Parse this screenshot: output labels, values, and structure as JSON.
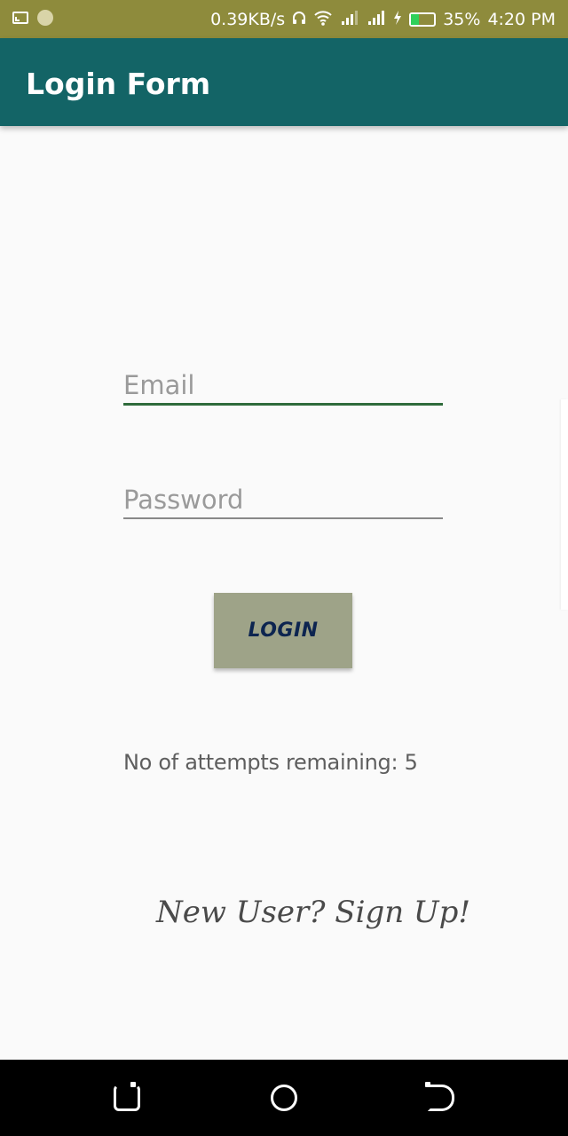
{
  "status_bar": {
    "network_speed": "0.39KB/s",
    "battery_percent": "35%",
    "time": "4:20 PM",
    "icons": [
      "cast-icon",
      "notification-dot-icon",
      "headphones-icon",
      "wifi-icon",
      "signal-icon",
      "signal-icon",
      "charging-icon",
      "battery-icon"
    ],
    "battery_level": 0.35,
    "battery_color": "#30D05A",
    "background_color": "#8E8B3C"
  },
  "app_bar": {
    "title": "Login Form",
    "background_color": "#136466"
  },
  "form": {
    "email_placeholder": "Email",
    "email_value": "",
    "password_placeholder": "Password",
    "password_value": "",
    "login_label": "LOGIN",
    "login_button_color": "#9EA388",
    "login_text_color": "#0D2550"
  },
  "attempts_text": "No of attempts remaining: 5",
  "signup_text": "New User? Sign Up!",
  "nav_bar": {
    "buttons": [
      "recent-apps-icon",
      "home-icon",
      "back-icon"
    ]
  }
}
